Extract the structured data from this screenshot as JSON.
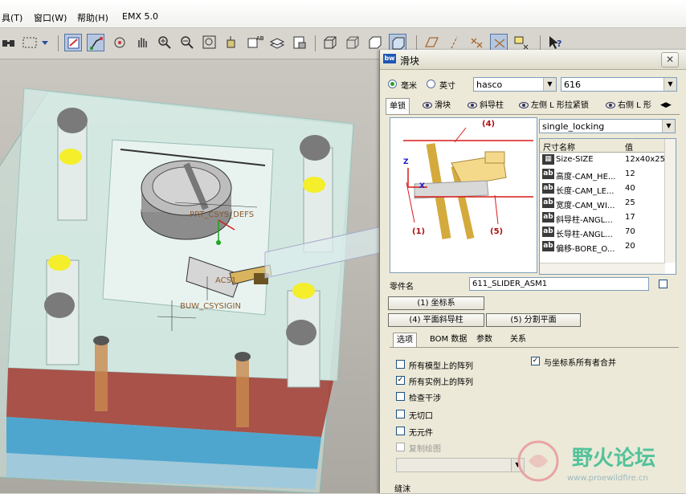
{
  "menu": {
    "items": [
      "具(T)",
      "窗口(W)",
      "帮助(H)",
      "EMX 5.0"
    ]
  },
  "viewport": {
    "labels": [
      "PRT_CSYS_DEFS",
      "ACS1",
      "BUW_CSYSIGIN"
    ],
    "colors": {
      "plate_bottom": "#a33c33",
      "plate_blue": "#4ea6cf",
      "screw_yellow": "#f4ee2b"
    }
  },
  "dialog": {
    "title": "滑块",
    "close_label": "✕",
    "units": {
      "mm": "毫米",
      "inch": "英寸",
      "selected": "mm"
    },
    "supplier": "hasco",
    "catalog": "616",
    "tabs": [
      "单锁",
      "滑块",
      "斜导柱",
      "左侧 L 形拉紧锁",
      "右侧 L 形"
    ],
    "preview_labels": [
      "(4)",
      "(1)",
      "(5)",
      "Z",
      "X"
    ],
    "type_select": "single_locking",
    "grid": {
      "headers": [
        "尺寸名称",
        "值"
      ],
      "rows": [
        {
          "icon": "grid-icon",
          "name": "Size-SIZE",
          "value": "12x40x25"
        },
        {
          "icon": "ab",
          "name": "高度-CAM_HE...",
          "value": "12"
        },
        {
          "icon": "ab",
          "name": "长度-CAM_LE...",
          "value": "40"
        },
        {
          "icon": "ab",
          "name": "宽度-CAM_WI...",
          "value": "25"
        },
        {
          "icon": "ab",
          "name": "斜导柱-ANGL...",
          "value": "17"
        },
        {
          "icon": "ab",
          "name": "长导柱-ANGL...",
          "value": "70"
        },
        {
          "icon": "ab",
          "name": "偏移-BORE_O...",
          "value": "20"
        }
      ]
    },
    "part_name_label": "零件名",
    "part_name": "611_SLIDER_ASM1",
    "buttons": {
      "csys": "(1) 坐标系",
      "plane_pin": "(4) 平面斜导柱",
      "parting_plane": "(5) 分割平面"
    },
    "subtabs": [
      "选项",
      "BOM 数据",
      "参数",
      "关系"
    ],
    "options": [
      {
        "label": "所有模型上的阵列",
        "checked": false,
        "disabled": false
      },
      {
        "label": "所有实例上的阵列",
        "checked": true,
        "disabled": false
      },
      {
        "label": "检查干涉",
        "checked": false,
        "disabled": false
      },
      {
        "label": "无切口",
        "checked": false,
        "disabled": false
      },
      {
        "label": "无元件",
        "checked": false,
        "disabled": false
      },
      {
        "label": "复制绘图",
        "checked": false,
        "disabled": true
      }
    ],
    "merge_option": {
      "label": "与坐标系所有者合并",
      "checked": true
    },
    "bottom_label": "缝沫"
  },
  "watermark": {
    "title": "野火论坛",
    "url": "www.proewildfire.cn"
  }
}
